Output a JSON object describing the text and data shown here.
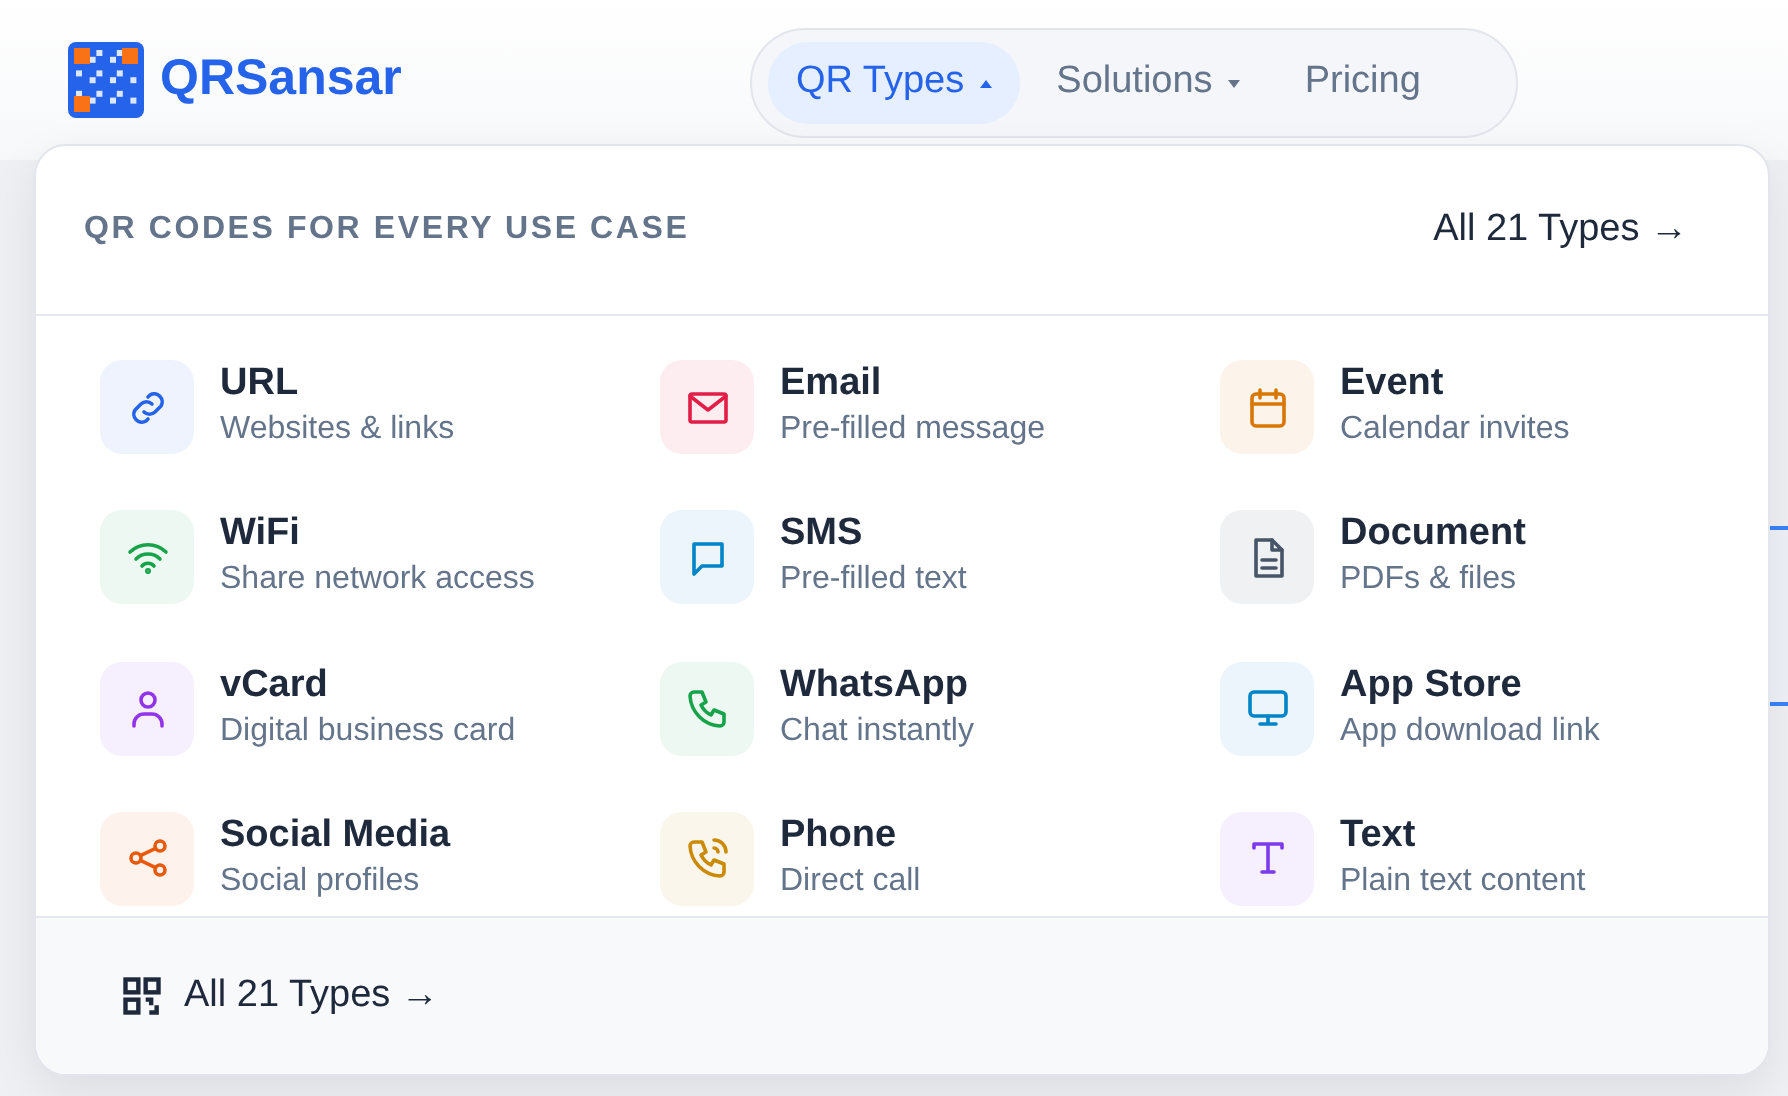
{
  "brand": {
    "name": "QRSansar"
  },
  "nav": [
    {
      "label": "QR Types",
      "kind": "menu",
      "selected": true,
      "expanded": true
    },
    {
      "label": "Solutions",
      "kind": "menu",
      "selected": false,
      "expanded": false
    },
    {
      "label": "Pricing",
      "kind": "link",
      "selected": false
    }
  ],
  "dropdown": {
    "heading": "QR CODES FOR EVERY USE CASE",
    "header_link": "All 21 Types →",
    "items": [
      {
        "title": "URL",
        "subtitle": "Websites & links",
        "color": "#2563eb"
      },
      {
        "title": "Email",
        "subtitle": "Pre-filled message",
        "color": "#e11d48"
      },
      {
        "title": "Event",
        "subtitle": "Calendar invites",
        "color": "#d97706"
      },
      {
        "title": "WiFi",
        "subtitle": "Share network access",
        "color": "#16a34a"
      },
      {
        "title": "SMS",
        "subtitle": "Pre-filled text",
        "color": "#0284c7"
      },
      {
        "title": "Document",
        "subtitle": "PDFs & files",
        "color": "#475569"
      },
      {
        "title": "vCard",
        "subtitle": "Digital business card",
        "color": "#9333ea"
      },
      {
        "title": "WhatsApp",
        "subtitle": "Chat instantly",
        "color": "#16a34a"
      },
      {
        "title": "App Store",
        "subtitle": "App download link",
        "color": "#0284c7"
      },
      {
        "title": "Social Media",
        "subtitle": "Social profiles",
        "color": "#ea580c"
      },
      {
        "title": "Phone",
        "subtitle": "Direct call",
        "color": "#ca8a04"
      },
      {
        "title": "Text",
        "subtitle": "Plain text content",
        "color": "#7c3aed"
      }
    ],
    "footer_link": "All 21 Types →"
  }
}
